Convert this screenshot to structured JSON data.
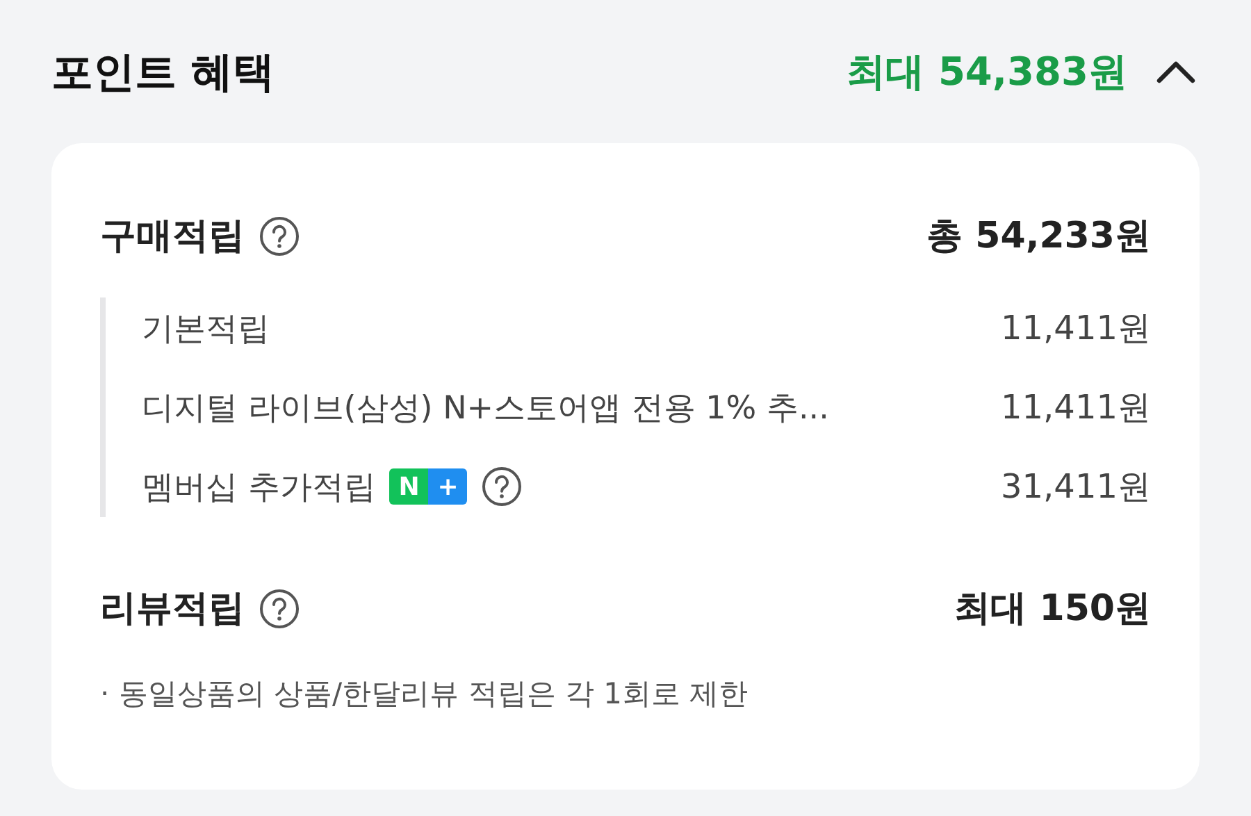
{
  "header": {
    "title": "포인트 혜택",
    "total": "최대 54,383원",
    "expanded": true
  },
  "sections": [
    {
      "label": "구매적립",
      "help": true,
      "amount": "총 54,233원",
      "items": [
        {
          "label": "기본적립",
          "amount": "11,411원"
        },
        {
          "label": "디지털 라이브(삼성) N+스토어앱 전용 1% 추...",
          "amount": "11,411원"
        },
        {
          "label": "멤버십 추가적립",
          "badge": [
            "N",
            "+"
          ],
          "help": true,
          "amount": "31,411원"
        }
      ]
    },
    {
      "label": "리뷰적립",
      "help": true,
      "amount": "최대 150원",
      "notes": [
        "· 동일상품의 상품/한달리뷰 적립은 각 1회로 제한"
      ]
    }
  ]
}
